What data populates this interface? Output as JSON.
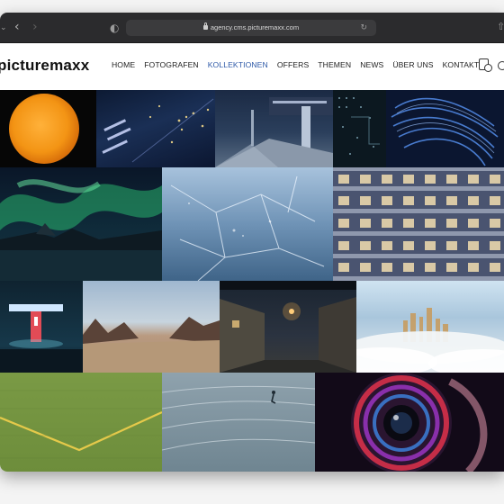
{
  "browser": {
    "url": "agency.cms.picturemaxx.com"
  },
  "site": {
    "logo_text": "picturemaxx",
    "nav": [
      {
        "label": "HOME",
        "active": false
      },
      {
        "label": "FOTOGRAFEN",
        "active": false
      },
      {
        "label": "KOLLEKTIONEN",
        "active": true
      },
      {
        "label": "OFFERS",
        "active": false
      },
      {
        "label": "THEMEN",
        "active": false
      },
      {
        "label": "NEWS",
        "active": false
      },
      {
        "label": "ÜBER UNS",
        "active": false
      },
      {
        "label": "KONTAKT",
        "active": false
      }
    ],
    "accent_color": "#2f5aa8"
  },
  "gallery": {
    "images": [
      {
        "subject": "sun-disc"
      },
      {
        "subject": "city-lights-aerial"
      },
      {
        "subject": "night-street-building"
      },
      {
        "subject": "circuit-board"
      },
      {
        "subject": "blue-fibers"
      },
      {
        "subject": "aurora-borealis"
      },
      {
        "subject": "frozen-ice"
      },
      {
        "subject": "building-facade"
      },
      {
        "subject": "neon-gas-station"
      },
      {
        "subject": "desert-mountains"
      },
      {
        "subject": "night-alley"
      },
      {
        "subject": "city-in-fog"
      },
      {
        "subject": "football-field"
      },
      {
        "subject": "running-track"
      },
      {
        "subject": "camera-lens"
      }
    ]
  }
}
